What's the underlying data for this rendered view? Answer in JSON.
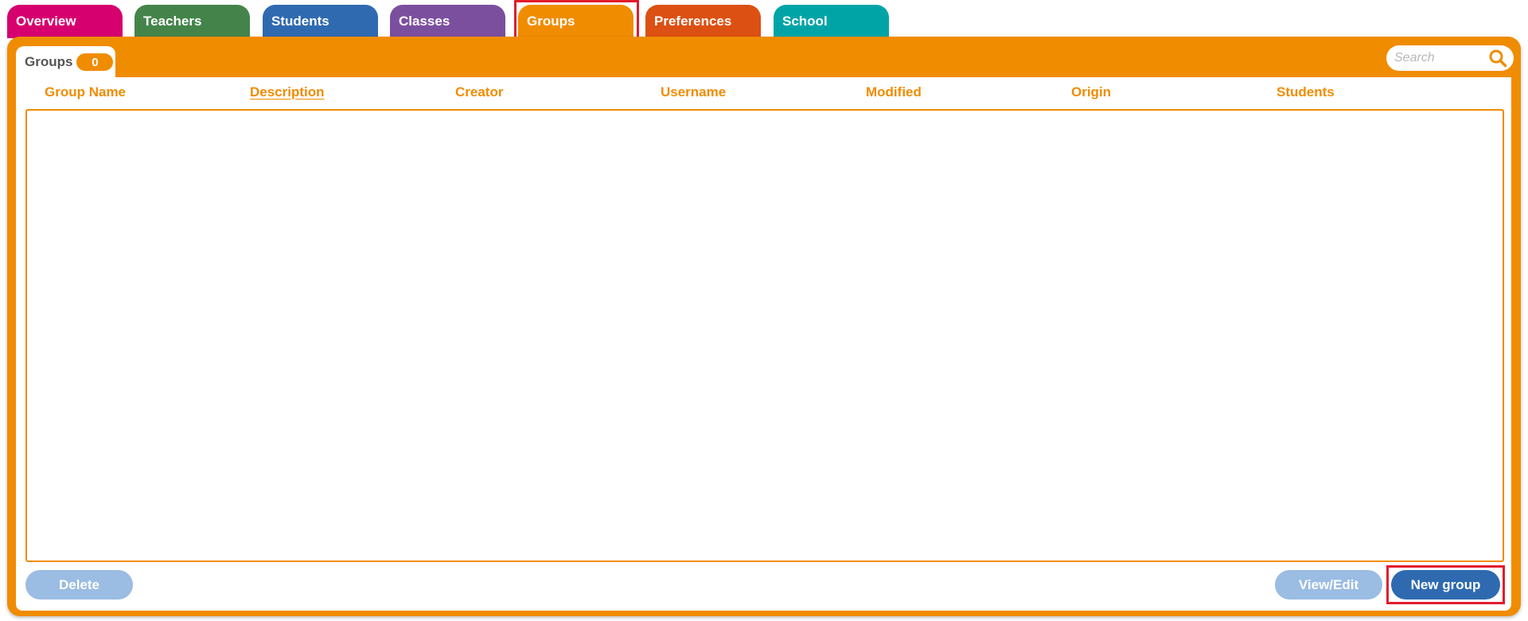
{
  "tabs": [
    {
      "label": "Overview",
      "color": "#d6006e"
    },
    {
      "label": "Teachers",
      "color": "#44844a"
    },
    {
      "label": "Students",
      "color": "#2f6ab0"
    },
    {
      "label": "Classes",
      "color": "#7b4f9e"
    },
    {
      "label": "Groups",
      "color": "#f08c00",
      "active": true
    },
    {
      "label": "Preferences",
      "color": "#dc5013"
    },
    {
      "label": "School",
      "color": "#00a4a7"
    }
  ],
  "subtab": {
    "label": "Groups",
    "count": "0"
  },
  "search": {
    "placeholder": "Search"
  },
  "columns": [
    {
      "label": "Group Name"
    },
    {
      "label": "Description",
      "sorted": true
    },
    {
      "label": "Creator"
    },
    {
      "label": "Username"
    },
    {
      "label": "Modified"
    },
    {
      "label": "Origin"
    },
    {
      "label": "Students"
    }
  ],
  "rows": [],
  "buttons": {
    "delete": "Delete",
    "view_edit": "View/Edit",
    "new_group": "New group"
  },
  "colors": {
    "accent": "#f08c00",
    "primary_button": "#2f6ab0",
    "disabled_button": "#9bbce3",
    "highlight": "#e21b2c"
  }
}
